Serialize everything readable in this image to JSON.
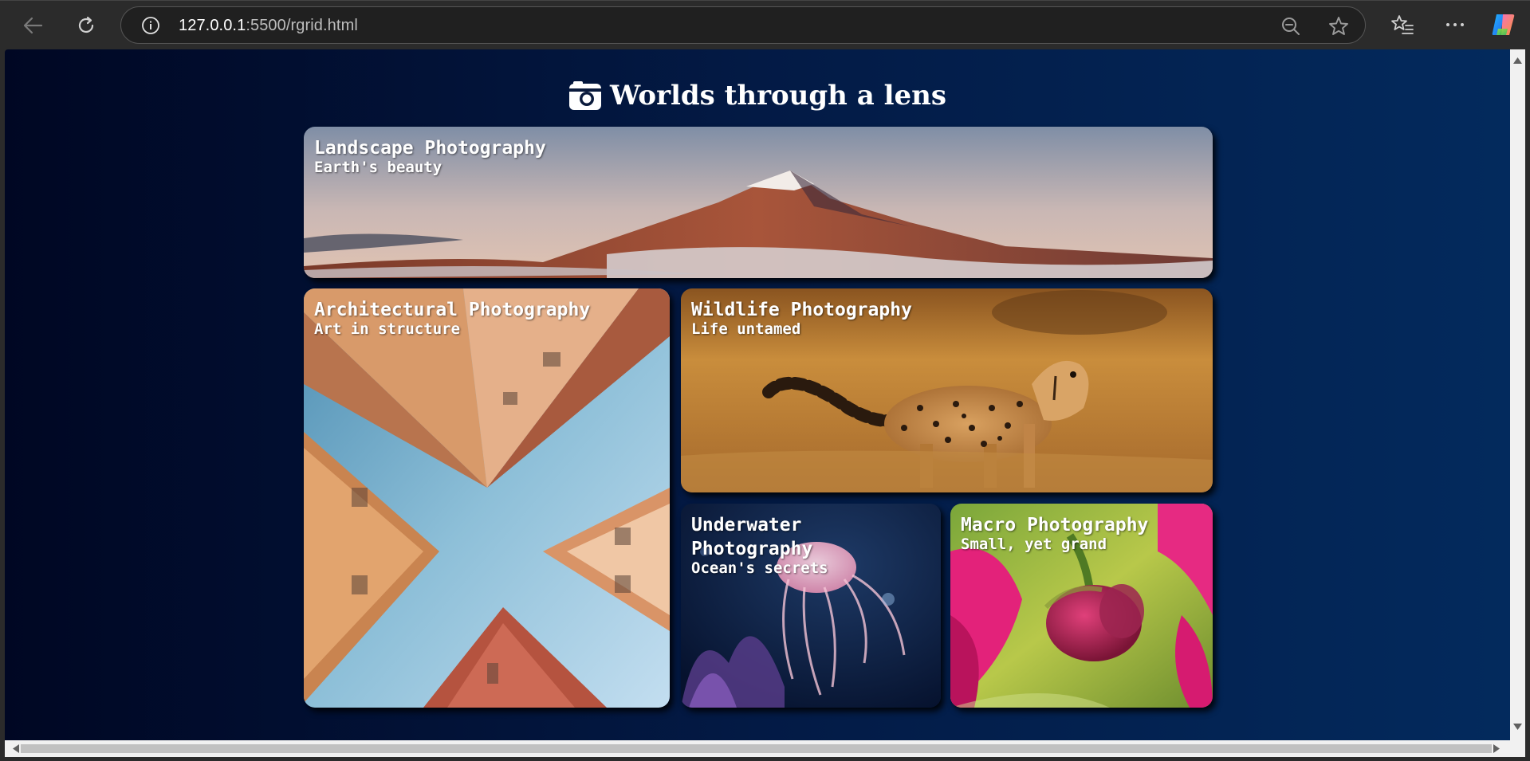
{
  "browser": {
    "url_host": "127.0.0.1",
    "url_rest": ":5500/rgrid.html"
  },
  "page": {
    "title": "Worlds through a lens",
    "title_icon": "camera-icon"
  },
  "cards": [
    {
      "title": "Landscape Photography",
      "subtitle": "Earth's beauty"
    },
    {
      "title": "Architectural Photography",
      "subtitle": "Art in structure"
    },
    {
      "title": "Wildlife Photography",
      "subtitle": "Life untamed"
    },
    {
      "title": "Underwater Photography",
      "subtitle": "Ocean's secrets"
    },
    {
      "title": "Macro Photography",
      "subtitle": "Small, yet grand"
    }
  ],
  "colors": {
    "background_gradient_start": "#000723",
    "background_gradient_end": "#032a5d",
    "chrome": "#2b2b2b",
    "text": "#ffffff"
  }
}
